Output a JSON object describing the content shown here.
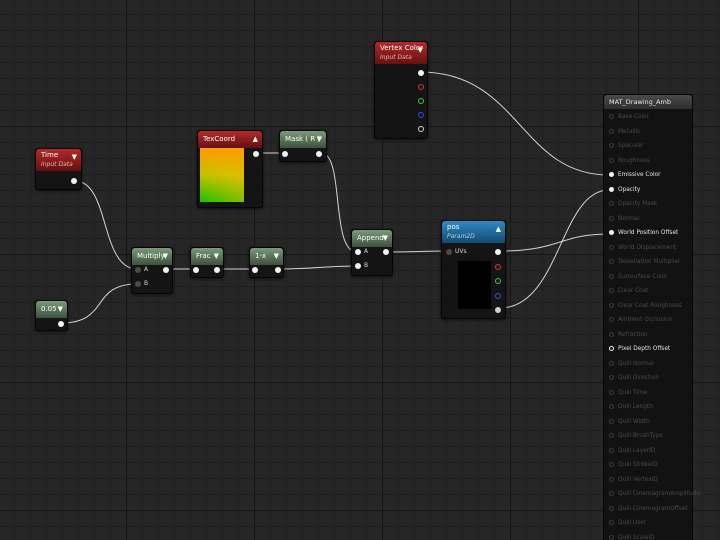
{
  "nodes": {
    "vertex_color": {
      "title": "Vertex Color",
      "subtitle": "Input Data"
    },
    "time": {
      "title": "Time",
      "subtitle": "Input Data"
    },
    "texcoord": {
      "title": "TexCoord"
    },
    "mask": {
      "title": "Mask ( R )"
    },
    "multiply": {
      "title": "Multiply",
      "pin_a": "A",
      "pin_b": "B"
    },
    "frac": {
      "title": "Frac"
    },
    "one_minus": {
      "title": "1-x"
    },
    "append": {
      "title": "Append",
      "pin_a": "A",
      "pin_b": "B"
    },
    "pos": {
      "title": "pos",
      "subtitle": "Param2D",
      "pin_uvs": "UVs"
    },
    "constant": {
      "title": "0.05"
    }
  },
  "material": {
    "title": "MAT_Drawing_Amb",
    "inputs": [
      {
        "label": "Base Color",
        "state": "inactive"
      },
      {
        "label": "Metallic",
        "state": "inactive"
      },
      {
        "label": "Specular",
        "state": "inactive"
      },
      {
        "label": "Roughness",
        "state": "inactive"
      },
      {
        "label": "Emissive Color",
        "state": "active"
      },
      {
        "label": "Opacity",
        "state": "active"
      },
      {
        "label": "Opacity Mask",
        "state": "inactive"
      },
      {
        "label": "Normal",
        "state": "inactive"
      },
      {
        "label": "World Position Offset",
        "state": "active"
      },
      {
        "label": "World Displacement",
        "state": "inactive"
      },
      {
        "label": "Tessellation Multiplier",
        "state": "inactive"
      },
      {
        "label": "Subsurface Color",
        "state": "inactive"
      },
      {
        "label": "Clear Coat",
        "state": "inactive"
      },
      {
        "label": "Clear Coat Roughness",
        "state": "inactive"
      },
      {
        "label": "Ambient Occlusion",
        "state": "inactive"
      },
      {
        "label": "Refraction",
        "state": "inactive"
      },
      {
        "label": "Pixel Depth Offset",
        "state": "hollow"
      },
      {
        "label": "Quill Normal",
        "state": "inactive"
      },
      {
        "label": "Quill Direction",
        "state": "inactive"
      },
      {
        "label": "Quill Time",
        "state": "inactive"
      },
      {
        "label": "Quill Length",
        "state": "inactive"
      },
      {
        "label": "Quill Width",
        "state": "inactive"
      },
      {
        "label": "Quill BrushType",
        "state": "inactive"
      },
      {
        "label": "Quill LayerID",
        "state": "inactive"
      },
      {
        "label": "Quill StrokeID",
        "state": "inactive"
      },
      {
        "label": "Quill VertexID",
        "state": "inactive"
      },
      {
        "label": "Quill CinemagramAmplitude",
        "state": "inactive"
      },
      {
        "label": "Quill CinemagramOffset",
        "state": "inactive"
      },
      {
        "label": "Quill User",
        "state": "inactive"
      },
      {
        "label": "Quill ScaleID",
        "state": "inactive"
      }
    ]
  },
  "icons": {
    "collapse": "▼",
    "expand": "▲"
  }
}
